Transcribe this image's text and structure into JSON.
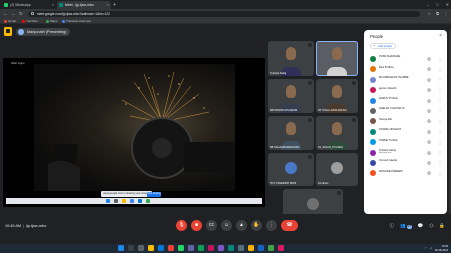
{
  "browser": {
    "tabs": [
      {
        "title": "(2) WhatsApp",
        "color": "#25d366",
        "active": false
      },
      {
        "title": "Meet - ijp-tjsw-mbo",
        "color": "#00897b",
        "active": true
      }
    ],
    "url": "meet.google.com/ijp-tjsw-mbo?authuser=1&hs=122",
    "bookmarks": [
      {
        "label": "Gmail",
        "color": "#ea4335"
      },
      {
        "label": "YouTube",
        "color": "#ff0000"
      },
      {
        "label": "Maps",
        "color": "#34a853"
      },
      {
        "label": "Translate Attempts",
        "color": "#4285f4"
      }
    ]
  },
  "meet": {
    "presenting": "Manjunath (Presenting)",
    "stage_label": "Web Apps",
    "share_notice": "meet.google.com is sharing your screen.",
    "stop_share": "Stop sharing",
    "meeting_time": "10:45 AM",
    "meeting_code": "ijp-tjsw-mbo",
    "people_badge": "27"
  },
  "tiles": [
    {
      "name": "Tushara Sahaj",
      "kind": "video",
      "shirt": "#2f2f5a",
      "speaking": false
    },
    {
      "name": "",
      "kind": "video",
      "shirt": "#d2d2d2",
      "speaking": true
    },
    {
      "name": "MB SHADIN KHAJIRAM",
      "kind": "video",
      "shirt": "#333d4d",
      "speaking": false
    },
    {
      "name": "S5 YOGA LAXMI ANKAM",
      "kind": "video",
      "shirt": "#4b3a2c",
      "speaking": false
    },
    {
      "name": "SB NAGA ERAMANANDA",
      "kind": "video",
      "shirt": "#40505f",
      "speaking": false
    },
    {
      "name": "S1_SUJAN_KH ANNA",
      "kind": "video",
      "shirt": "#2d4a3a",
      "speaking": false
    },
    {
      "name": "ITI P. PRAMODH ROHI",
      "kind": "avatar",
      "avatar_color": "#4a78c8",
      "speaking": false
    },
    {
      "name": "44 others",
      "kind": "avatar",
      "avatar_color": "#9e9e9e",
      "speaking": false
    },
    {
      "name": "KA_MOUNIKA BRAS",
      "kind": "avatar",
      "avatar_color": "#6f6f6f",
      "speaking": false
    }
  ],
  "people": {
    "title": "People",
    "add_label": "Add people",
    "list": [
      {
        "name": "PUSD KHAIRADE",
        "sub": "",
        "color": "#0b8043"
      },
      {
        "name": "Ravi B Mista",
        "sub": "",
        "color": "#e37400"
      },
      {
        "name": "MUVABKARAN THAMBE",
        "sub": "",
        "color": "#7986cb"
      },
      {
        "name": "jayram srikanth",
        "sub": "",
        "color": "#c2185b"
      },
      {
        "name": "DHRUV PIYALE",
        "sub": "",
        "color": "#1e88e5"
      },
      {
        "name": "SHELAR CHAITANYA",
        "sub": "",
        "color": "#5f6368"
      },
      {
        "name": "Tanaya Bor",
        "sub": "",
        "color": "#795548"
      },
      {
        "name": "TANDEL NISHANT",
        "sub": "",
        "color": "#00897b"
      },
      {
        "name": "TAWDE TUSHA",
        "sub": "",
        "color": "#039be5"
      },
      {
        "name": "Tushara Sahaj",
        "sub": "Meeting host",
        "color": "#8e24aa"
      },
      {
        "name": "Ummed Gawde",
        "sub": "",
        "color": "#3949ab"
      },
      {
        "name": "WANODE PREREM",
        "sub": "",
        "color": "#f4511e"
      }
    ]
  },
  "taskbar": {
    "time": "10:45",
    "date": "26-08-2024"
  }
}
